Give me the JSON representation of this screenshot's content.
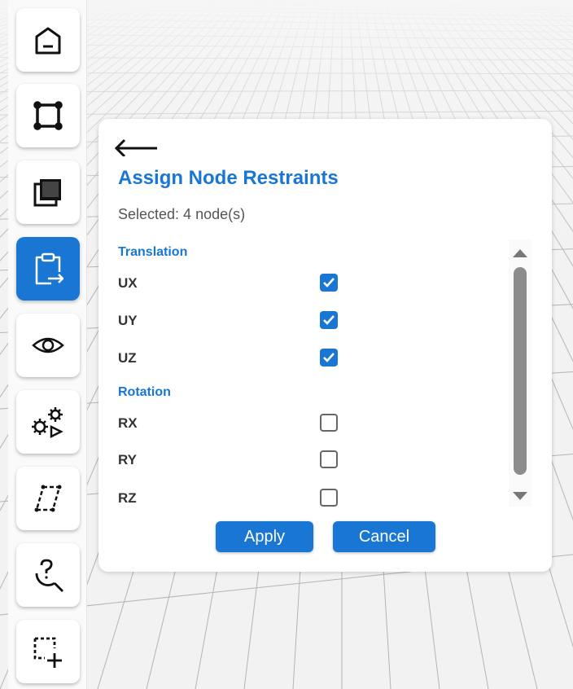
{
  "toolbar": {
    "items": [
      {
        "name": "home",
        "icon": "home-icon",
        "active": false
      },
      {
        "name": "select-square",
        "icon": "square-nodes-icon",
        "active": false
      },
      {
        "name": "layers",
        "icon": "layers-icon",
        "active": false
      },
      {
        "name": "assign",
        "icon": "clipboard-arrow-icon",
        "active": true
      },
      {
        "name": "view",
        "icon": "eye-icon",
        "active": false
      },
      {
        "name": "run-analysis",
        "icon": "gears-play-icon",
        "active": false
      },
      {
        "name": "shape-edit",
        "icon": "parallelogram-icon",
        "active": false
      },
      {
        "name": "query",
        "icon": "question-search-icon",
        "active": false
      },
      {
        "name": "add-selection",
        "icon": "dashed-box-plus-icon",
        "active": false
      }
    ]
  },
  "panel": {
    "title": "Assign Node Restraints",
    "selected_text": "Selected: 4 node(s)",
    "sections": [
      {
        "label": "Translation",
        "rows": [
          {
            "label": "UX",
            "checked": true
          },
          {
            "label": "UY",
            "checked": true
          },
          {
            "label": "UZ",
            "checked": true
          }
        ]
      },
      {
        "label": "Rotation",
        "rows": [
          {
            "label": "RX",
            "checked": false
          },
          {
            "label": "RY",
            "checked": false
          },
          {
            "label": "RZ",
            "checked": false
          }
        ]
      }
    ],
    "apply_label": "Apply",
    "cancel_label": "Cancel"
  },
  "colors": {
    "accent": "#1976d2",
    "grid": "#b8b8b8"
  }
}
